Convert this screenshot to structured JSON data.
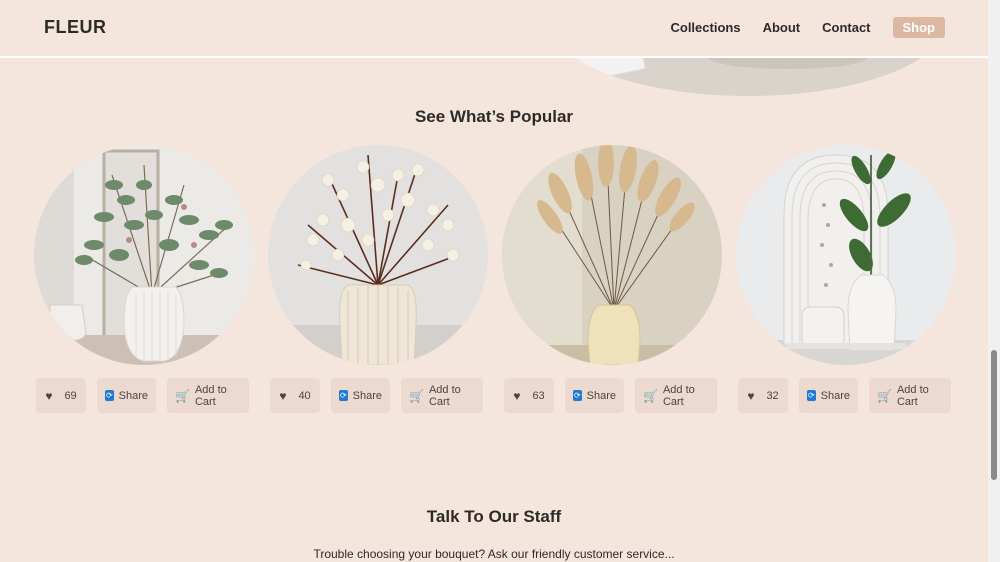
{
  "header": {
    "logo": "FLEUR",
    "nav": [
      "Collections",
      "About",
      "Contact"
    ],
    "shop_label": "Shop"
  },
  "popular": {
    "title": "See What’s Popular",
    "products": [
      {
        "likes": "69",
        "share_label": "Share",
        "cart_label": "Add to Cart"
      },
      {
        "likes": "40",
        "share_label": "Share",
        "cart_label": "Add to Cart"
      },
      {
        "likes": "63",
        "share_label": "Share",
        "cart_label": "Add to Cart"
      },
      {
        "likes": "32",
        "share_label": "Share",
        "cart_label": "Add to Cart"
      }
    ]
  },
  "staff": {
    "title": "Talk To Our Staff",
    "text": "Trouble choosing your bouquet? Ask our friendly customer service..."
  },
  "icons": {
    "like": "heart-icon",
    "share": "share-icon",
    "cart": "cart-icon"
  },
  "colors": {
    "background": "#f5e6dd",
    "accent": "#dcb8a3",
    "button": "#ecd9cf"
  }
}
